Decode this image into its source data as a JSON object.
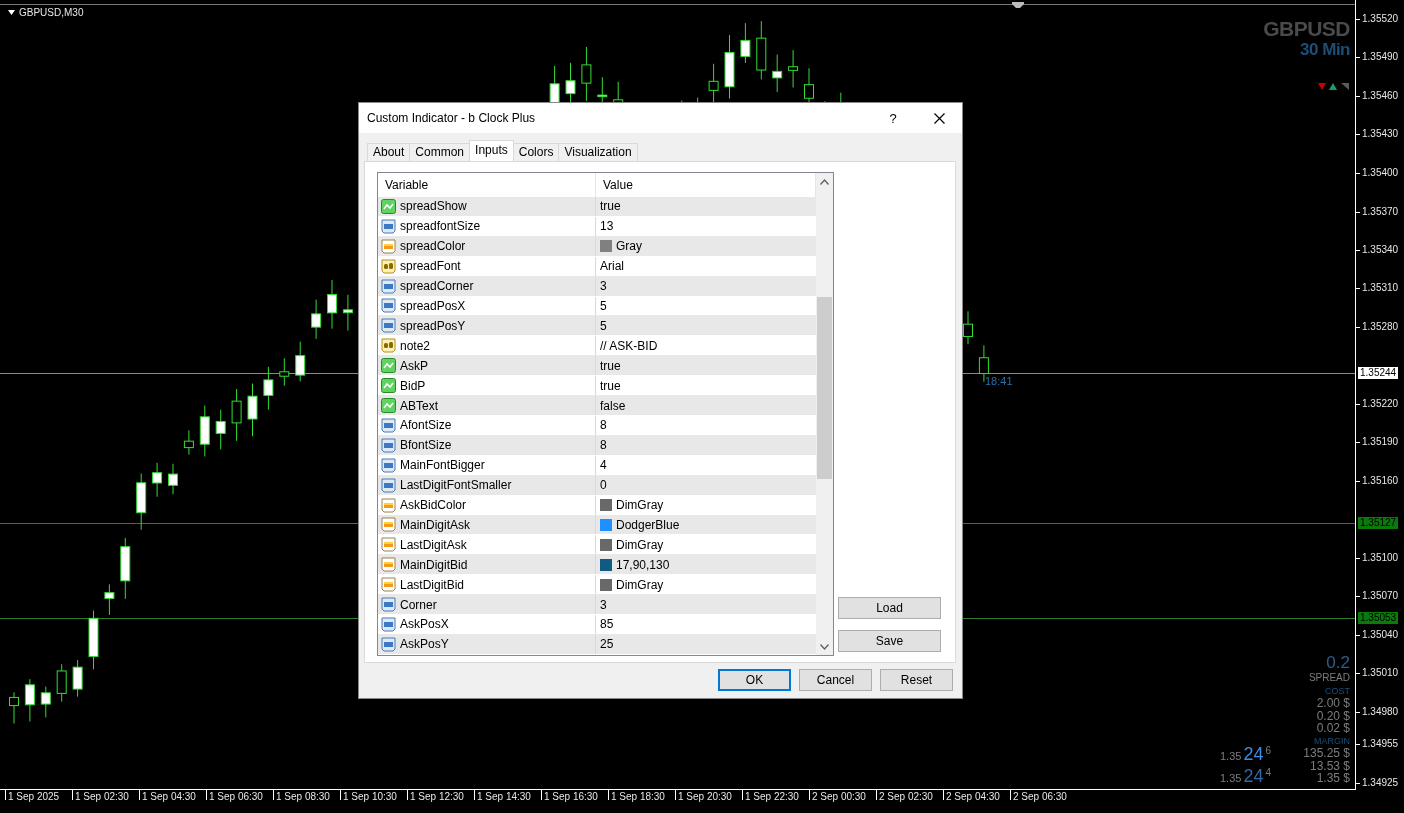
{
  "chart": {
    "symbol_label": "GBPUSD,M30",
    "watermark": {
      "symbol": "GBPUSD",
      "timeframe": "30 Min"
    },
    "countdown": "18:41",
    "price_axis": [
      "1.35520",
      "1.35490",
      "1.35460",
      "1.35430",
      "1.35400",
      "1.35370",
      "1.35340",
      "1.35310",
      "1.35280",
      "1.35220",
      "1.35190",
      "1.35160",
      "1.35100",
      "1.35070",
      "1.35040",
      "1.35010",
      "1.34980",
      "1.34955",
      "1.34925"
    ],
    "price_lines": [
      {
        "label": "1.35244",
        "kind": "bid"
      },
      {
        "label": "1.35127",
        "kind": "level"
      },
      {
        "label": "1.35053",
        "kind": "level"
      }
    ],
    "time_axis": [
      "1 Sep 2025",
      "1 Sep 02:30",
      "1 Sep 04:30",
      "1 Sep 06:30",
      "1 Sep 08:30",
      "1 Sep 10:30",
      "1 Sep 12:30",
      "1 Sep 14:30",
      "1 Sep 16:30",
      "1 Sep 18:30",
      "1 Sep 20:30",
      "1 Sep 22:30",
      "2 Sep 00:30",
      "2 Sep 02:30",
      "2 Sep 04:30",
      "2 Sep 06:30"
    ],
    "spread_panel": {
      "spread": "0.2",
      "spread_label": "SPREAD",
      "cost_label": "COST",
      "costs": [
        "2.00 $",
        "0.20 $",
        "0.02 $"
      ],
      "margin_label": "MARGIN",
      "margins": [
        "135.25 $",
        "13.53 $",
        "1.35 $"
      ]
    },
    "quotes": [
      {
        "kind": "ask",
        "prefix": "1.35",
        "main": "24",
        "last": "6"
      },
      {
        "kind": "bid",
        "prefix": "1.35",
        "main": "24",
        "last": "4"
      }
    ]
  },
  "dialog": {
    "title": "Custom Indicator - b Clock Plus",
    "help": "?",
    "tabs": [
      {
        "label": "About",
        "selected": false
      },
      {
        "label": "Common",
        "selected": false
      },
      {
        "label": "Inputs",
        "selected": true
      },
      {
        "label": "Colors",
        "selected": false
      },
      {
        "label": "Visualization",
        "selected": false
      }
    ],
    "columns": [
      "Variable",
      "Value"
    ],
    "rows": [
      {
        "kind": "bool",
        "name": "spreadShow",
        "value": "true"
      },
      {
        "kind": "int",
        "name": "spreadfontSize",
        "value": "13"
      },
      {
        "kind": "color",
        "name": "spreadColor",
        "value": "Gray",
        "color": "#808080"
      },
      {
        "kind": "string",
        "name": "spreadFont",
        "value": "Arial"
      },
      {
        "kind": "int",
        "name": "spreadCorner",
        "value": "3"
      },
      {
        "kind": "int",
        "name": "spreadPosX",
        "value": "5"
      },
      {
        "kind": "int",
        "name": "spreadPosY",
        "value": "5"
      },
      {
        "kind": "string",
        "name": "note2",
        "value": "// ASK-BID"
      },
      {
        "kind": "bool",
        "name": "AskP",
        "value": "true"
      },
      {
        "kind": "bool",
        "name": "BidP",
        "value": "true"
      },
      {
        "kind": "bool",
        "name": "ABText",
        "value": "false"
      },
      {
        "kind": "int",
        "name": "AfontSize",
        "value": "8"
      },
      {
        "kind": "int",
        "name": "BfontSize",
        "value": "8"
      },
      {
        "kind": "int",
        "name": "MainFontBigger",
        "value": "4"
      },
      {
        "kind": "int",
        "name": "LastDigitFontSmaller",
        "value": "0"
      },
      {
        "kind": "color",
        "name": "AskBidColor",
        "value": "DimGray",
        "color": "#696969"
      },
      {
        "kind": "color",
        "name": "MainDigitAsk",
        "value": "DodgerBlue",
        "color": "#1e90ff"
      },
      {
        "kind": "color",
        "name": "LastDigitAsk",
        "value": "DimGray",
        "color": "#696969"
      },
      {
        "kind": "color",
        "name": "MainDigitBid",
        "value": "17,90,130",
        "color": "#115a82"
      },
      {
        "kind": "color",
        "name": "LastDigitBid",
        "value": "DimGray",
        "color": "#696969"
      },
      {
        "kind": "int",
        "name": "Corner",
        "value": "3"
      },
      {
        "kind": "int",
        "name": "AskPosX",
        "value": "85"
      },
      {
        "kind": "int",
        "name": "AskPosY",
        "value": "25"
      }
    ],
    "side_buttons": [
      "Load",
      "Save"
    ],
    "buttons": [
      {
        "label": "OK",
        "default": true
      },
      {
        "label": "Cancel",
        "default": false
      },
      {
        "label": "Reset",
        "default": false
      }
    ]
  }
}
